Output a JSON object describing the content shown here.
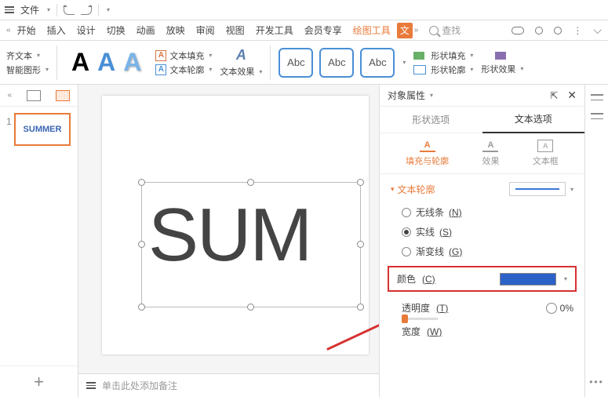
{
  "topbar": {
    "file": "文件"
  },
  "tabs": {
    "items": [
      "开始",
      "插入",
      "设计",
      "切换",
      "动画",
      "放映",
      "审阅",
      "视图",
      "开发工具",
      "会员专享"
    ],
    "drawing": "绘图工具",
    "text_icon": "文"
  },
  "search": {
    "placeholder": "查找"
  },
  "ribbon": {
    "align_text": "齐文本",
    "smart_graphic": "智能图形",
    "text_fill": "文本填充",
    "text_outline": "文本轮廓",
    "text_effect": "文本效果",
    "abc": "Abc",
    "shape_fill": "形状填充",
    "shape_outline": "形状轮廓",
    "shape_effect": "形状效果"
  },
  "thumb": {
    "num": "1",
    "text": "SUMMER"
  },
  "canvas": {
    "text": "SUM"
  },
  "notes": {
    "placeholder": "单击此处添加备注"
  },
  "panel": {
    "title": "对象属性",
    "shape_options": "形状选项",
    "text_options": "文本选项",
    "fill_outline": "填充与轮廓",
    "effect": "效果",
    "textbox": "文本框",
    "section": "文本轮廓",
    "radio_none": "无线条",
    "radio_none_k": "(N)",
    "radio_solid": "实线",
    "radio_solid_k": "(S)",
    "radio_gradient": "渐变线",
    "radio_gradient_k": "(G)",
    "color": "颜色",
    "color_k": "(C)",
    "trans": "透明度",
    "trans_k": "(T)",
    "trans_val": "0%",
    "width": "宽度",
    "width_k": "(W)"
  }
}
